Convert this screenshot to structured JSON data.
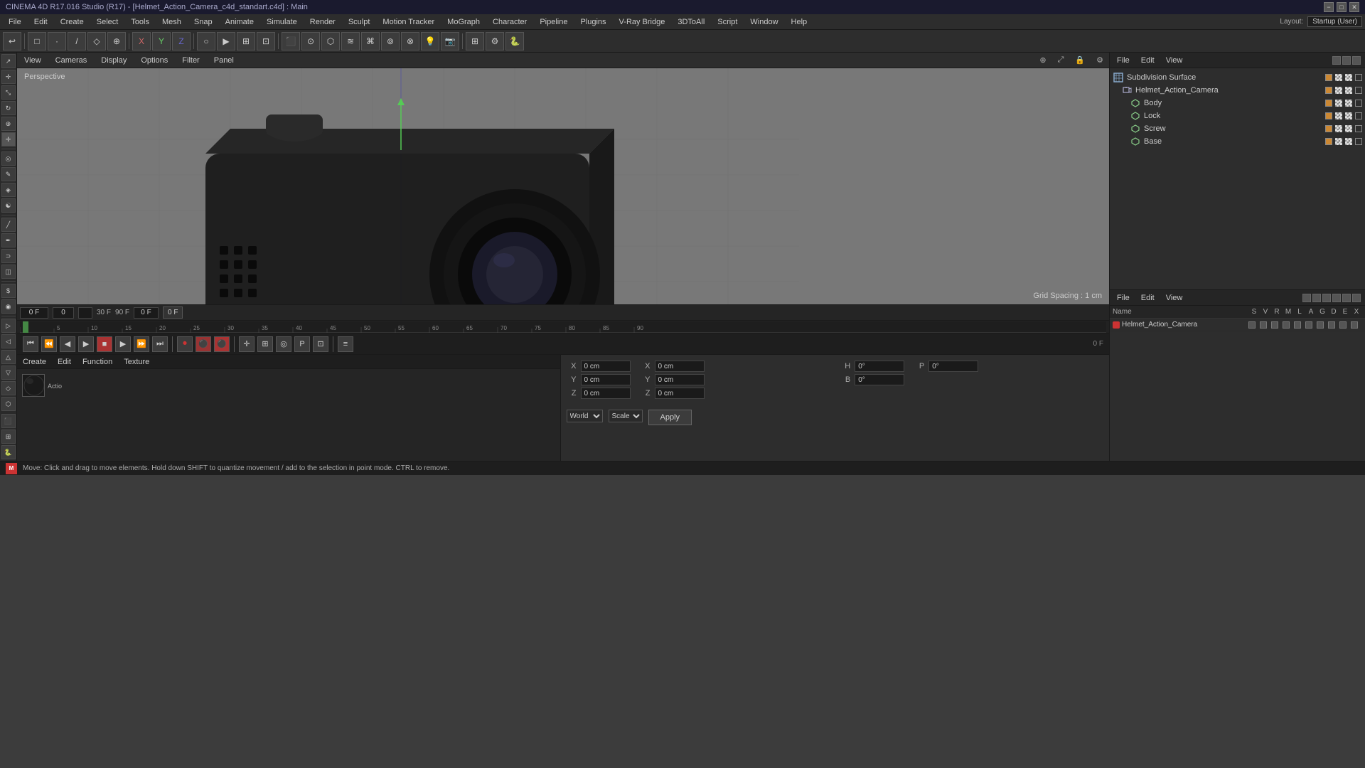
{
  "titleBar": {
    "title": "CINEMA 4D R17.016 Studio (R17) - [Helmet_Action_Camera_c4d_standart.c4d] : Main",
    "winControls": [
      "−",
      "□",
      "✕"
    ]
  },
  "menuBar": {
    "items": [
      "File",
      "Edit",
      "Create",
      "Select",
      "Tools",
      "Mesh",
      "Snap",
      "Animate",
      "Simulate",
      "Render",
      "Sculpt",
      "Motion Tracker",
      "MoGraph",
      "Character",
      "Pipeline",
      "Plugins",
      "V-Ray Bridge",
      "3DToAll",
      "Script",
      "Window",
      "Help"
    ]
  },
  "layout": {
    "label": "Layout:",
    "value": "Startup (User)"
  },
  "viewport": {
    "perspective": "Perspective",
    "viewMenuItems": [
      "View",
      "Cameras",
      "Display",
      "Options",
      "Filter",
      "Panel"
    ],
    "gridSpacing": "Grid Spacing : 1 cm"
  },
  "objectTree": {
    "header": [
      "File",
      "Edit",
      "View"
    ],
    "items": [
      {
        "id": "subdivision-surface",
        "label": "Subdivision Surface",
        "indent": 0,
        "type": "null",
        "icon": "⊞"
      },
      {
        "id": "helmet-action-camera",
        "label": "Helmet_Action_Camera",
        "indent": 1,
        "type": "null",
        "icon": "⊞"
      },
      {
        "id": "body",
        "label": "Body",
        "indent": 2,
        "type": "mesh",
        "icon": "△"
      },
      {
        "id": "lock",
        "label": "Lock",
        "indent": 2,
        "type": "mesh",
        "icon": "△"
      },
      {
        "id": "screw",
        "label": "Screw",
        "indent": 2,
        "type": "mesh",
        "icon": "△"
      },
      {
        "id": "base",
        "label": "Base",
        "indent": 2,
        "type": "mesh",
        "icon": "△"
      }
    ]
  },
  "objectsPanel": {
    "header": [
      "File",
      "Edit",
      "View"
    ],
    "columns": [
      "Name",
      "S",
      "V",
      "R",
      "M",
      "L",
      "A",
      "G",
      "D",
      "E",
      "X"
    ],
    "rows": [
      {
        "name": "Helmet_Action_Camera",
        "values": [
          "•",
          "•",
          "•",
          "•",
          "•",
          "•",
          "•",
          "•",
          "•",
          "•"
        ]
      }
    ]
  },
  "timeline": {
    "startFrame": "0 F",
    "currentFrame": "0",
    "fps": "30 F",
    "endFrame": "90 F",
    "outFrame": "0 F",
    "loopField": "0",
    "frameIndicator": "0 F",
    "rulers": [
      "0",
      "5",
      "10",
      "15",
      "20",
      "25",
      "30",
      "35",
      "40",
      "45",
      "50",
      "55",
      "60",
      "65",
      "70",
      "75",
      "80",
      "85",
      "90"
    ]
  },
  "transport": {
    "buttons": [
      {
        "id": "go-start",
        "icon": "⏮",
        "label": "Go to Start"
      },
      {
        "id": "prev-key",
        "icon": "⏪",
        "label": "Previous Keyframe"
      },
      {
        "id": "prev-frame",
        "icon": "◀",
        "label": "Previous Frame"
      },
      {
        "id": "play",
        "icon": "▶",
        "label": "Play"
      },
      {
        "id": "stop",
        "icon": "■",
        "label": "Stop"
      },
      {
        "id": "next-frame",
        "icon": "▶",
        "label": "Next Frame"
      },
      {
        "id": "next-key",
        "icon": "⏩",
        "label": "Next Keyframe"
      },
      {
        "id": "go-end",
        "icon": "⏭",
        "label": "Go to End"
      }
    ]
  },
  "materialEditor": {
    "header": [
      "Create",
      "Edit",
      "Function",
      "Texture"
    ],
    "materials": [
      {
        "id": "action-camera-mat",
        "label": "Actio",
        "color": "#1a1a1a"
      }
    ]
  },
  "coordinates": {
    "x": {
      "label": "X",
      "pos": "0 cm",
      "posLabel": "X",
      "rot": "0°"
    },
    "y": {
      "label": "Y",
      "pos": "0 cm",
      "posLabel": "Y",
      "rot": "0°"
    },
    "z": {
      "label": "Z",
      "pos": "0 cm",
      "posLabel": "Z",
      "rot": "0°"
    },
    "h": {
      "label": "H",
      "val": "0°"
    },
    "p": {
      "label": "P",
      "val": "0°"
    },
    "b": {
      "label": "B",
      "val": "0°"
    },
    "coordSystem": "World",
    "sizeSystem": "Scale",
    "applyLabel": "Apply"
  },
  "statusBar": {
    "message": "Move: Click and drag to move elements. Hold down SHIFT to quantize movement / add to the selection in point mode. CTRL to remove."
  },
  "colors": {
    "accent": "#4a6fa5",
    "bg": "#2d2d2d",
    "darkBg": "#1a1a1a",
    "viewport": "#787878",
    "gridLine": "#6a6a6a",
    "axisX": "#cc3333",
    "axisY": "#33cc33",
    "axisZ": "#3333cc"
  }
}
